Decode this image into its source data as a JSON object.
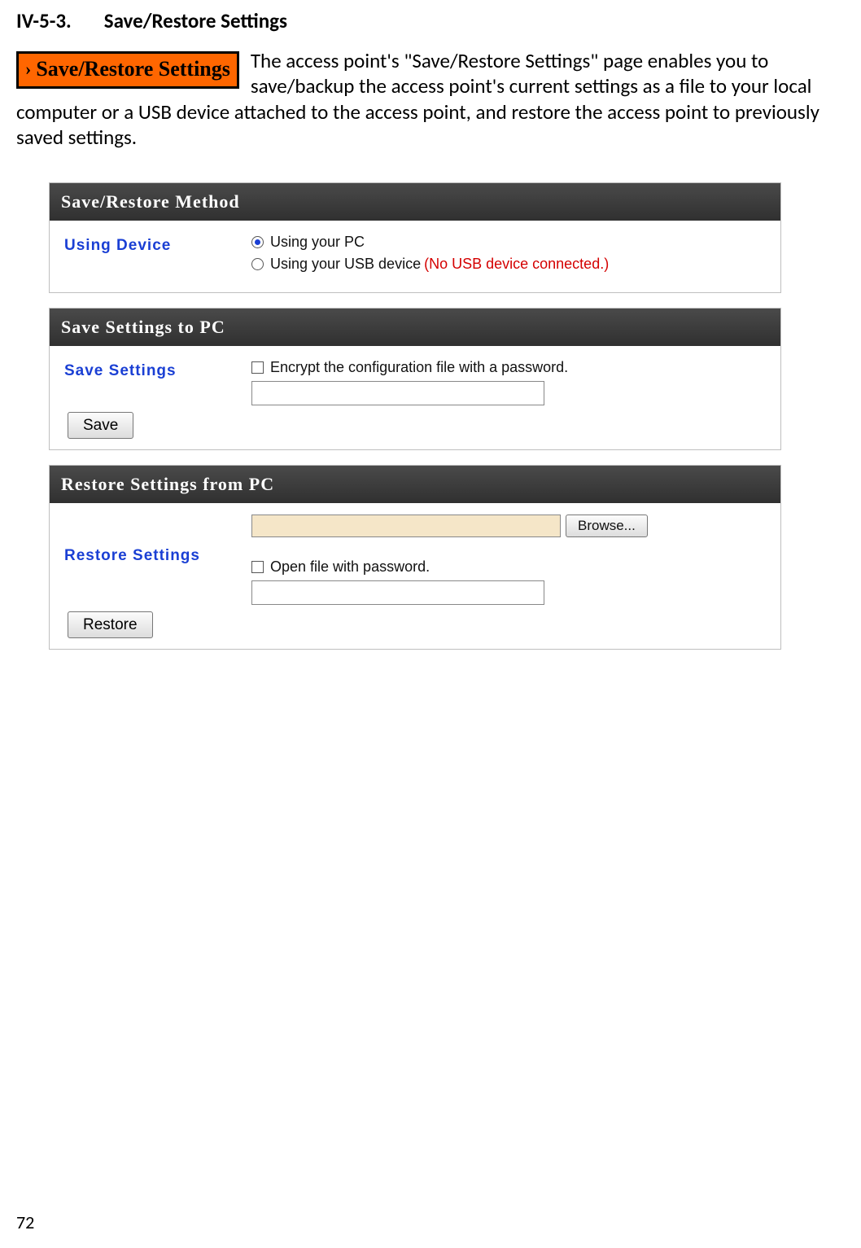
{
  "heading": {
    "number": "IV-5-3.",
    "title": "Save/Restore Settings"
  },
  "badge": {
    "chevron": "›",
    "label": "Save/Restore Settings"
  },
  "intro": "The access point's \"Save/Restore Settings\" page enables you to save/backup the access point's current settings as a file to your local computer or a USB device attached to the access point, and restore the access point to previously saved settings.",
  "method_panel": {
    "header": "Save/Restore Method",
    "row_label": "Using Device",
    "opt_pc": "Using your PC",
    "opt_usb": "Using your USB device",
    "usb_note": "(No USB device connected.)"
  },
  "save_panel": {
    "header": "Save Settings to PC",
    "row_label": "Save Settings",
    "encrypt_label": "Encrypt the configuration file with a password.",
    "button": "Save"
  },
  "restore_panel": {
    "header": "Restore Settings from PC",
    "row_label": "Restore Settings",
    "browse": "Browse...",
    "pw_label": "Open file with password.",
    "button": "Restore"
  },
  "page_number": "72"
}
